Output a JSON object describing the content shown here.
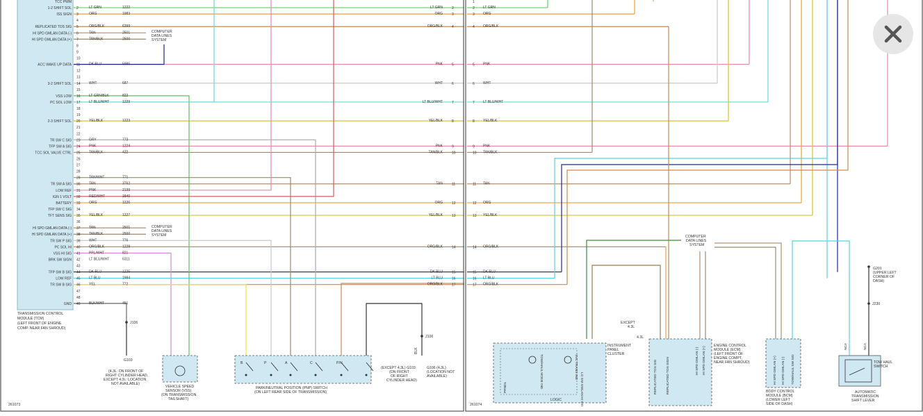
{
  "left_page": {
    "page_number": "261073",
    "tcm_pins": [
      {
        "row": 0,
        "pin": "",
        "label": "TCC PWM",
        "color": "",
        "circuit": ""
      },
      {
        "row": 1,
        "pin": "2",
        "label": "1-2 SHIFT SOL",
        "color": "LT GRN",
        "circuit": "1222"
      },
      {
        "row": 2,
        "pin": "3",
        "label": "ISS SIGN",
        "color": "ORG",
        "circuit": "1983"
      },
      {
        "row": 3,
        "pin": "4",
        "label": "",
        "color": "",
        "circuit": ""
      },
      {
        "row": 4,
        "pin": "5",
        "label": "REPLICATED TOS SIG",
        "color": "ORG/BLK",
        "circuit": "6399"
      },
      {
        "row": 5,
        "pin": "6",
        "label": "HI SPD GMLAN DATA (-)",
        "color": "TAN",
        "circuit": "2501"
      },
      {
        "row": 6,
        "pin": "7",
        "label": "HI SPD GMLAN DATA (+)",
        "color": "TAN/BLK",
        "circuit": "2500"
      },
      {
        "row": 7,
        "pin": "8",
        "label": "",
        "color": "",
        "circuit": ""
      },
      {
        "row": 8,
        "pin": "9",
        "label": "",
        "color": "",
        "circuit": ""
      },
      {
        "row": 9,
        "pin": "10",
        "label": "",
        "color": "",
        "circuit": ""
      },
      {
        "row": 10,
        "pin": "11",
        "label": "ACC WAKE UP DATA",
        "color": "DK BLU",
        "circuit": "5985"
      },
      {
        "row": 11,
        "pin": "12",
        "label": "",
        "color": "",
        "circuit": ""
      },
      {
        "row": 12,
        "pin": "13",
        "label": "",
        "color": "",
        "circuit": ""
      },
      {
        "row": 13,
        "pin": "14",
        "label": "3-2 SHIFT SOL",
        "color": "WHT",
        "circuit": "687"
      },
      {
        "row": 14,
        "pin": "15",
        "label": "",
        "color": "",
        "circuit": ""
      },
      {
        "row": 15,
        "pin": "16",
        "label": "VSS LOW",
        "color": "LT GRN/BLK",
        "circuit": "822"
      },
      {
        "row": 16,
        "pin": "17",
        "label": "PC SOL LOW",
        "color": "LT BLU/WHT",
        "circuit": "1229"
      },
      {
        "row": 17,
        "pin": "18",
        "label": "",
        "color": "",
        "circuit": ""
      },
      {
        "row": 18,
        "pin": "19",
        "label": "",
        "color": "",
        "circuit": ""
      },
      {
        "row": 19,
        "pin": "20",
        "label": "2-3 SHIFT SOL",
        "color": "YEL/BLK",
        "circuit": "1223"
      },
      {
        "row": 20,
        "pin": "21",
        "label": "",
        "color": "",
        "circuit": ""
      },
      {
        "row": 21,
        "pin": "22",
        "label": "",
        "color": "",
        "circuit": ""
      },
      {
        "row": 22,
        "pin": "23",
        "label": "TR SW C SIG",
        "color": "GRY",
        "circuit": "773"
      },
      {
        "row": 23,
        "pin": "24",
        "label": "TFP SW A SIG",
        "color": "PNK",
        "circuit": "1224"
      },
      {
        "row": 24,
        "pin": "25",
        "label": "TCC SOL VALVE CTRL",
        "color": "TAN/BLK",
        "circuit": "422"
      },
      {
        "row": 25,
        "pin": "26",
        "label": "",
        "color": "",
        "circuit": ""
      },
      {
        "row": 26,
        "pin": "27",
        "label": "",
        "color": "",
        "circuit": ""
      },
      {
        "row": 27,
        "pin": "28",
        "label": "",
        "color": "",
        "circuit": ""
      },
      {
        "row": 28,
        "pin": "29",
        "label": "",
        "color": "TAN/WHT",
        "circuit": "771"
      },
      {
        "row": 29,
        "pin": "30",
        "label": "TR SW A SIG",
        "color": "TAN",
        "circuit": "3762"
      },
      {
        "row": 30,
        "pin": "31",
        "label": "LOW REF",
        "color": "PNK",
        "circuit": "2139"
      },
      {
        "row": 31,
        "pin": "32",
        "label": "IGN 1 VOLT",
        "color": "RED/WHT",
        "circuit": "1840"
      },
      {
        "row": 32,
        "pin": "33",
        "label": "BATTERY",
        "color": "ORG",
        "circuit": "1226"
      },
      {
        "row": 33,
        "pin": "34",
        "label": "TFP SW C SIG",
        "color": "",
        "circuit": ""
      },
      {
        "row": 34,
        "pin": "35",
        "label": "TFT SENS SIG",
        "color": "YEL/BLK",
        "circuit": "1227"
      },
      {
        "row": 35,
        "pin": "36",
        "label": "",
        "color": "",
        "circuit": ""
      },
      {
        "row": 36,
        "pin": "37",
        "label": "HI SPD GMLAN DATA (-)",
        "color": "TAN",
        "circuit": "2501"
      },
      {
        "row": 37,
        "pin": "38",
        "label": "HI SPD GMLAN DATA (+)",
        "color": "TAN/BLK",
        "circuit": "2500"
      },
      {
        "row": 38,
        "pin": "39",
        "label": "TR SW P SIG",
        "color": "WHT",
        "circuit": "776"
      },
      {
        "row": 39,
        "pin": "40",
        "label": "PC SOL HI",
        "color": "ORG/BLK",
        "circuit": "1228"
      },
      {
        "row": 40,
        "pin": "41",
        "label": "VSS HI SIG",
        "color": "PPL/WHT",
        "circuit": "821"
      },
      {
        "row": 41,
        "pin": "42",
        "label": "BRK SW SIGN",
        "color": "LT BLU/WHT",
        "circuit": "6311"
      },
      {
        "row": 42,
        "pin": "43",
        "label": "",
        "color": "",
        "circuit": ""
      },
      {
        "row": 43,
        "pin": "44",
        "label": "TFP SW B SIG",
        "color": "DK BLU",
        "circuit": "1225"
      },
      {
        "row": 44,
        "pin": "45",
        "label": "LOW REF",
        "color": "LT BLU",
        "circuit": "1984"
      },
      {
        "row": 45,
        "pin": "46",
        "label": "TR SW B SIG",
        "color": "YEL",
        "circuit": "772"
      },
      {
        "row": 46,
        "pin": "47",
        "label": "",
        "color": "",
        "circuit": ""
      },
      {
        "row": 47,
        "pin": "48",
        "label": "",
        "color": "",
        "circuit": ""
      },
      {
        "row": 48,
        "pin": "49",
        "label": "GND",
        "color": "BLK/WHT",
        "circuit": "451"
      }
    ],
    "tcm_caption": [
      "TRANSMISSION CONTROL",
      "MODULE (TCM)",
      "(LEFT FRONT OF ENGINE",
      "COMP. NEAR FAN SHROUD)"
    ],
    "data_lines_label": [
      "COMPUTER",
      "DATA LINES",
      "SYSTEM"
    ],
    "right_edge": [
      {
        "row": 1,
        "color": "LT GRN",
        "num": "2"
      },
      {
        "row": 2,
        "color": "ORG",
        "num": "3"
      },
      {
        "row": 4,
        "color": "ORG/BLK",
        "num": "4"
      },
      {
        "row": 10,
        "color": "PNK",
        "num": "5"
      },
      {
        "row": 13,
        "color": "WHT",
        "num": "6"
      },
      {
        "row": 16,
        "color": "LT BLU/WHT",
        "num": "7"
      },
      {
        "row": 19,
        "color": "YEL/BLK",
        "num": "8"
      },
      {
        "row": 23,
        "color": "PNK",
        "num": "9"
      },
      {
        "row": 24,
        "color": "TAN/BLK",
        "num": "10"
      },
      {
        "row": 29,
        "color": "TAN",
        "num": "11"
      },
      {
        "row": 32,
        "color": "ORG",
        "num": "12"
      },
      {
        "row": 34,
        "color": "YEL/BLK",
        "num": "13"
      },
      {
        "row": 39,
        "color": "ORG/BLK",
        "num": "14"
      },
      {
        "row": 43,
        "color": "DK BLU",
        "num": "15"
      },
      {
        "row": 44,
        "color": "LT BLU",
        "num": "16"
      },
      {
        "row": 45,
        "color": "ORG/BLK",
        "num": "17"
      }
    ],
    "j106_top": "J106",
    "g103_caption": [
      "(4.3L: ON FRONT OF",
      "RIGHT CYLINDER HEAD,",
      "EXCEPT 4.3L: LOCATION",
      "NOT AVAILABLE)"
    ],
    "g103": "G103",
    "vss_wires": [
      "PPL/WHT",
      "LT GRN/BLK"
    ],
    "vss_caption": [
      "VEHICLE SPEED",
      "SENSOR (VSS)",
      "(ON TRANSMISSION",
      "TAILSHAFT)"
    ],
    "pnp_wires": [
      "YEL",
      "WHT",
      "TAN/WHT",
      "GRY",
      "ORG/BLK",
      "BLK"
    ],
    "pnp_letters": [
      "B",
      "P",
      "A",
      "C",
      "P/N"
    ],
    "pnp_caption": [
      "PARK/NEUTRAL POSITION (PNP) SWITCH",
      "(ON LEFT REAR SIDE OF TRANSMISSION)"
    ],
    "g103_right_caption": [
      "(EXCEPT 4.3L) G103",
      "(ON FRONT",
      "OF RIGHT",
      "CYLINDER HEAD)"
    ],
    "g106_caption": [
      "G106 (4.3L)",
      "(LOCATION NOT",
      "AVAILABLE)"
    ],
    "j106_right": "J106",
    "blk": "BLK"
  },
  "right_page": {
    "page_number": "261074",
    "left_labels": [
      {
        "row": 0,
        "num": "1",
        "color": ""
      },
      {
        "row": 1,
        "num": "2",
        "color": "LT GRN"
      },
      {
        "row": 2,
        "num": "3",
        "color": "ORG"
      },
      {
        "row": 4,
        "num": "4",
        "color": "ORG/BLK"
      },
      {
        "row": 10,
        "num": "5",
        "color": "PNK"
      },
      {
        "row": 13,
        "num": "6",
        "color": "WHT"
      },
      {
        "row": 16,
        "num": "7",
        "color": "LT BLU/WHT"
      },
      {
        "row": 19,
        "num": "8",
        "color": "YEL/BLK"
      },
      {
        "row": 23,
        "num": "9",
        "color": "PNK"
      },
      {
        "row": 24,
        "num": "10",
        "color": "TAN/BLK"
      },
      {
        "row": 29,
        "num": "11",
        "color": "TAN"
      },
      {
        "row": 32,
        "num": "12",
        "color": "ORG"
      },
      {
        "row": 34,
        "num": "13",
        "color": "YEL/BLK"
      },
      {
        "row": 39,
        "num": "14",
        "color": "ORG/BLK"
      },
      {
        "row": 43,
        "num": "15",
        "color": "DK BLU"
      },
      {
        "row": 44,
        "num": "16",
        "color": "LT BLU"
      },
      {
        "row": 45,
        "num": "17",
        "color": "ORG/BLK"
      }
    ],
    "data_lines_label": [
      "COMPUTER",
      "DATA LINES",
      "SYSTEM"
    ],
    "ipc_caption": [
      "INSTRUMENT",
      "PANEL",
      "CLUSTER"
    ],
    "ipc_wires": [
      {
        "code": "5990",
        "color": "DK GRN",
        "pin": "6"
      },
      {
        "code": "419",
        "color": "BRN/WHT",
        "pin": "16"
      }
    ],
    "ipc_internal": [
      "TOW/HAUL MODE IND",
      "SVC TRANS IND",
      "LO GM GMLAN HI SIG",
      "LOGIC",
      "PRNDL"
    ],
    "ecm_wires": [
      {
        "code": "419",
        "color": "ORG/GRN",
        "pin": "27"
      },
      {
        "code": "5990",
        "color": "GRN/WHT",
        "pin": "58"
      },
      {
        "code": "6399",
        "color": "ORG/BLK",
        "pin": "71"
      },
      {
        "code": "2501",
        "color": "TAN",
        "pin": "27"
      },
      {
        "code": "2500",
        "color": "TAN/BLK",
        "pin": "28"
      }
    ],
    "ecm_internal": [
      "REPLICATED TOS SIG",
      "REPLICATED TOS SIGN",
      "HI SPD GMLAN (-)",
      "HI SPD GMLAN (+)"
    ],
    "ecm_caption": [
      "ENGINE CONTROL",
      "MODULE (ECM)",
      "(LEFT FRONT OF",
      "ENGINE COMPT,",
      "NEAR FAN SHROUD)"
    ],
    "ecm_connectors": [
      "C1",
      "C2",
      "C3"
    ],
    "ecm_pin_nums": [
      "54",
      "44",
      "43"
    ],
    "except_label": [
      "EXCEPT",
      "4.3L"
    ],
    "l43_label": "4.3L",
    "bcm_wires": [
      {
        "code": "2500",
        "color": "TAN/BLK",
        "pin": "A"
      },
      {
        "code": "2501",
        "color": "TAN",
        "pin": "B"
      },
      {
        "code": "553",
        "color": "LT BLU",
        "pin": "C2"
      }
    ],
    "bcm_internal": [
      "HI SPD GMLAN (+)",
      "HI SPD GMLAN (-)",
      "TOW/HAUL SW SIG"
    ],
    "bcm_caption": [
      "BODY CONTROL",
      "MODULE (BCM)",
      "(LOWER LEFT",
      "SIDE OF DASH)"
    ],
    "switch_wires": [
      "LT BLU",
      "BLK",
      "BLK"
    ],
    "switch_codes": [
      "553",
      "1550",
      "1550"
    ],
    "g201_caption": [
      "G201",
      "(UPPER LEFT",
      "CORNER OF",
      "DASH)"
    ],
    "j230": "J230",
    "tow_switch": [
      "TOW HAUL",
      "SWITCH"
    ],
    "auto_shift_caption": [
      "AUTOMATIC",
      "TRANSMISSION",
      "SHIFT LEVER"
    ],
    "nca": "NCA",
    "pin_a": "A",
    "pin_b": "B"
  },
  "close_button": {
    "icon": "close-icon"
  },
  "wire_colors": {
    "LT GRN": "#5ed45e",
    "ORG": "#e9a040",
    "ORG/BLK": "#c98a50",
    "PNK": "#e58ab0",
    "WHT": "#c7c7c7",
    "LT BLU/WHT": "#6ed3ea",
    "YEL/BLK": "#d4c23a",
    "TAN/BLK": "#9a8a6a",
    "TAN": "#b09070",
    "RED/WHT": "#d75a5a",
    "DK BLU": "#1a2a88",
    "LT BLU": "#58d2ea",
    "YEL": "#efe62e",
    "DK GRN": "#3a8a3a",
    "GRY": "#aaaaaa",
    "PPL/WHT": "#d98ad9",
    "LT GRN/BLK": "#60c060",
    "BLK": "#333333",
    "BLK/WHT": "#666666",
    "BRN/WHT": "#9a7a55"
  }
}
